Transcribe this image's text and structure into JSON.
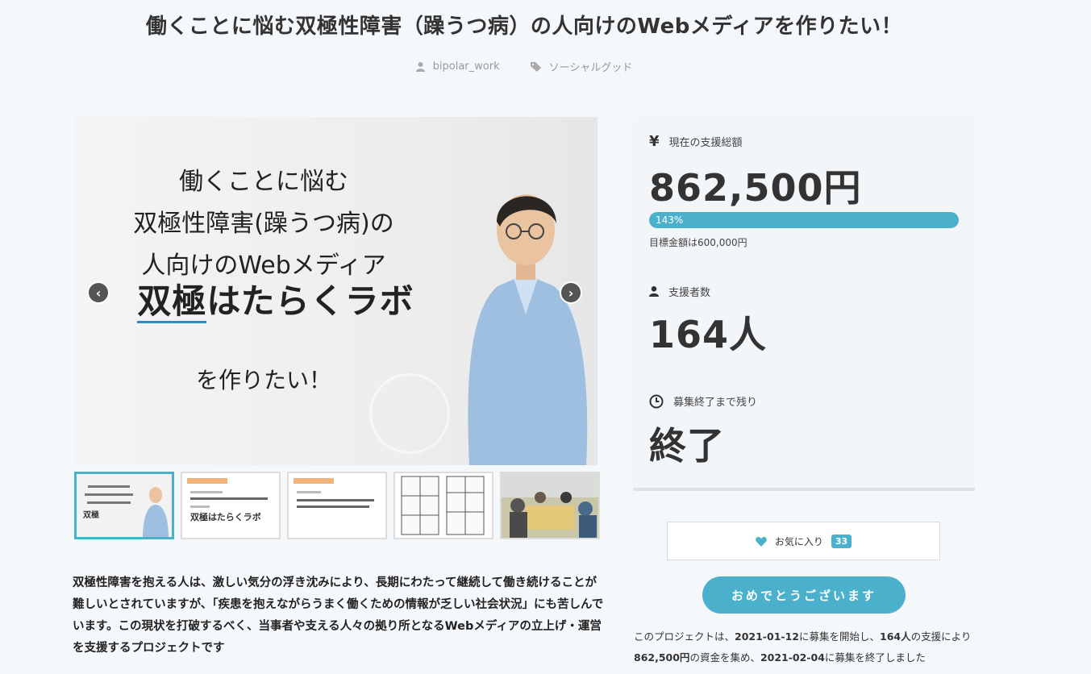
{
  "page": {
    "title": "働くことに悩む双極性障害（躁うつ病）の人向けのWebメディアを作りたい！",
    "author": "bipolar_work",
    "category": "ソーシャルグッド"
  },
  "hero": {
    "line1": "働くことに悩む",
    "line2": "双極性障害(躁うつ病)の",
    "line3": "人向けのWebメディア",
    "logo_a": "双極",
    "logo_b": "はたらくラボ",
    "line4": "を作りたい！",
    "prev": "‹",
    "next": "›"
  },
  "thumbnails": [
    {
      "kind": "cover"
    },
    {
      "kind": "slide",
      "header": "Webメディア概要",
      "logo": "双極はたらくラボ"
    },
    {
      "kind": "slide",
      "header": "Webメディア概要"
    },
    {
      "kind": "manga"
    },
    {
      "kind": "photo"
    }
  ],
  "description": "双極性障害を抱える人は、激しい気分の浮き沈みにより、長期にわたって継続して働き続けることが難しいとされていますが、「疾患を抱えながらうまく働くための情報が乏しい社会状況」にも苦しんでいます。この現状を打破するべく、当事者や支える人々の拠り所となるWebメディアの立上げ・運営を支援するプロジェクトです",
  "stats": {
    "funding_icon": "¥",
    "funding_label": "現在の支援総額",
    "funding_value": "862,500円",
    "progress_label": "143%",
    "progress_fraction": 1.0,
    "goal_label": "目標金額は600,000円",
    "backers_label": "支援者数",
    "backers_value": "164人",
    "remaining_label": "募集終了まで残り",
    "remaining_value": "終了"
  },
  "favorite": {
    "label": "お気に入り",
    "count": "33"
  },
  "congrats_label": "おめでとうございます",
  "summary": {
    "pre": "このプロジェクトは、",
    "start": "2021-01-12",
    "mid1": "に募集を開始し、",
    "backers": "164人",
    "mid2": "の支援により",
    "amount": "862,500円",
    "mid3": "の資金を集め、",
    "end": "2021-02-04",
    "post": "に募集を終了しました"
  },
  "colors": {
    "accent": "#4ab0cc",
    "background": "#f5f8fb"
  }
}
